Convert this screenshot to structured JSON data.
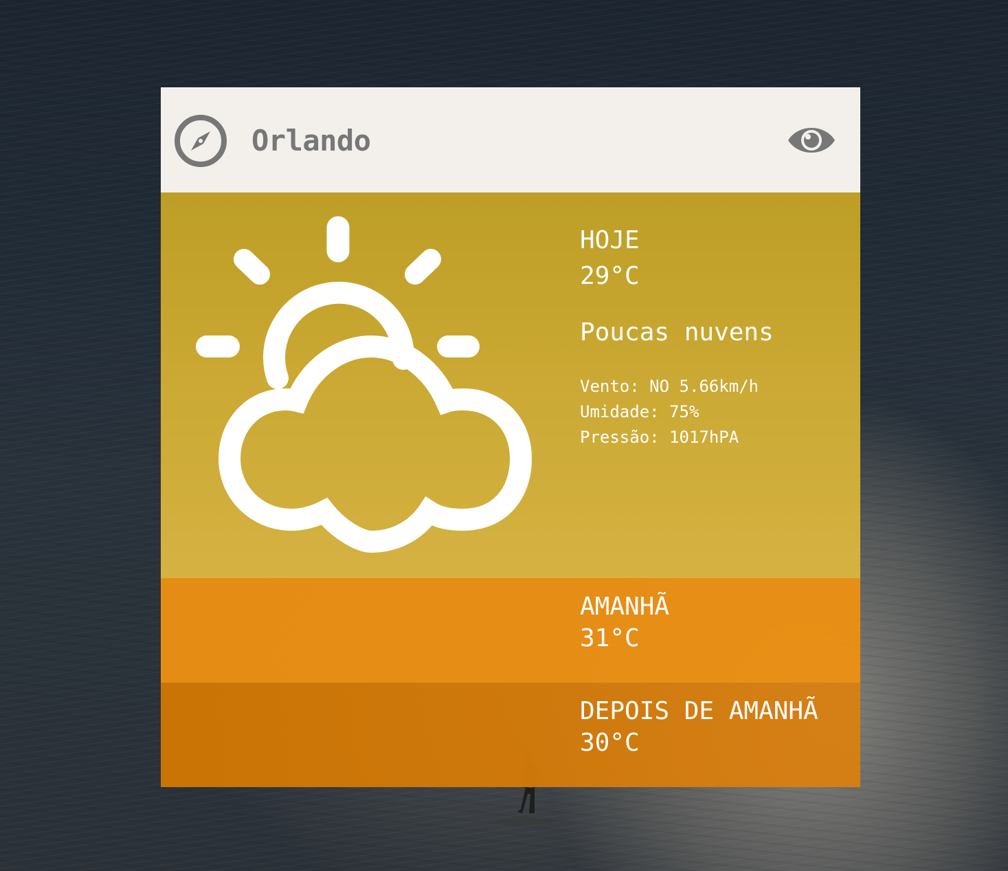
{
  "header": {
    "city": "Orlando",
    "location_icon": "compass-icon",
    "toggle_icon": "eye-icon"
  },
  "today": {
    "label": "HOJE",
    "temperature": "29°C",
    "description": "Poucas nuvens",
    "wind": "Vento: NO 5.66km/h",
    "humidity": "Umidade: 75%",
    "pressure": "Pressão: 1017hPA",
    "icon": "partly-cloudy-icon"
  },
  "tomorrow": {
    "label": "AMANHÃ",
    "temperature": "31°C"
  },
  "day_after": {
    "label": "DEPOIS DE AMANHÃ",
    "temperature": "30°C"
  },
  "colors": {
    "header_bg": "#f3f0ec",
    "header_text": "#777777",
    "today_bg": "#c8a535",
    "tomorrow_bg": "#eb9014",
    "day_after_bg": "#d27a06",
    "text": "#ffffff"
  }
}
